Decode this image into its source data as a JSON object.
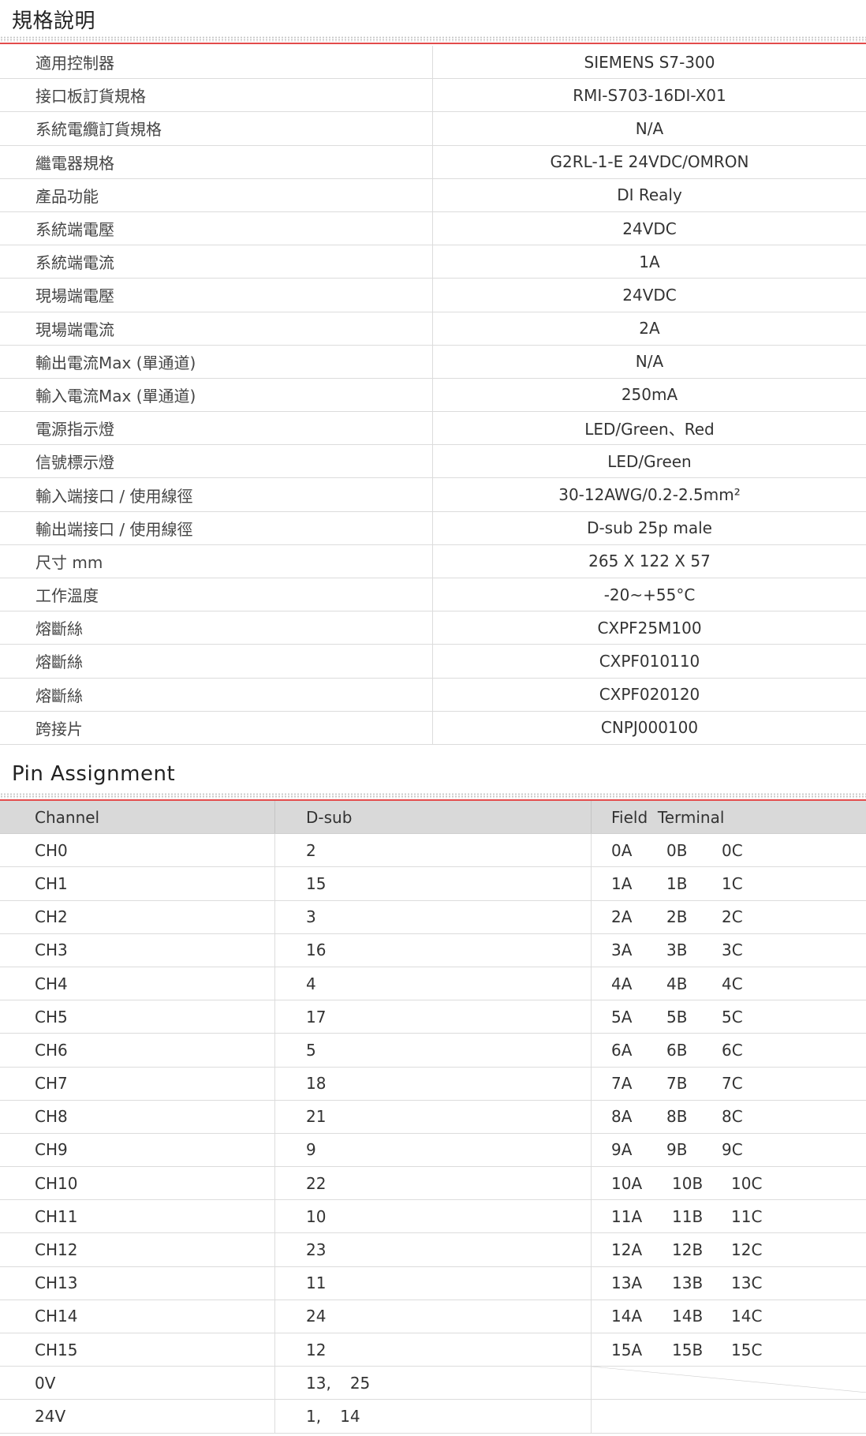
{
  "spec_section": {
    "title": "規格說明",
    "rows": [
      {
        "label": "適用控制器",
        "value": "SIEMENS S7-300"
      },
      {
        "label": "接口板訂貨規格",
        "value": "RMI-S703-16DI-X01"
      },
      {
        "label": "系統電纜訂貨規格",
        "value": "N/A"
      },
      {
        "label": "繼電器規格",
        "value": "G2RL-1-E 24VDC/OMRON"
      },
      {
        "label": "產品功能",
        "value": "DI Realy"
      },
      {
        "label": "系統端電壓",
        "value": "24VDC"
      },
      {
        "label": "系統端電流",
        "value": "1A"
      },
      {
        "label": "現場端電壓",
        "value": "24VDC"
      },
      {
        "label": "現場端電流",
        "value": "2A"
      },
      {
        "label": "輸出電流Max (單通道)",
        "value": "N/A"
      },
      {
        "label": "輸入電流Max (單通道)",
        "value": "250mA"
      },
      {
        "label": "電源指示燈",
        "value": "LED/Green、Red"
      },
      {
        "label": "信號標示燈",
        "value": "LED/Green"
      },
      {
        "label": "輸入端接口 / 使用線徑",
        "value": "30-12AWG/0.2-2.5mm²"
      },
      {
        "label": "輸出端接口 / 使用線徑",
        "value": "D-sub 25p male"
      },
      {
        "label": "尺寸 mm",
        "value": "265 X 122 X 57"
      },
      {
        "label": "工作溫度",
        "value": "-20~+55°C"
      },
      {
        "label": "熔斷絲",
        "value": "CXPF25M100"
      },
      {
        "label": "熔斷絲",
        "value": "CXPF010110"
      },
      {
        "label": "熔斷絲",
        "value": "CXPF020120"
      },
      {
        "label": "跨接片",
        "value": "CNPJ000100"
      }
    ]
  },
  "pin_section": {
    "title": "Pin Assignment",
    "headers": {
      "channel": "Channel",
      "dsub": "D-sub",
      "field": "Field  Terminal"
    },
    "rows": [
      {
        "channel": "CH0",
        "dsub": [
          "2"
        ],
        "terminals": [
          "0A",
          "0B",
          "0C"
        ]
      },
      {
        "channel": "CH1",
        "dsub": [
          "15"
        ],
        "terminals": [
          "1A",
          "1B",
          "1C"
        ]
      },
      {
        "channel": "CH2",
        "dsub": [
          "3"
        ],
        "terminals": [
          "2A",
          "2B",
          "2C"
        ]
      },
      {
        "channel": "CH3",
        "dsub": [
          "16"
        ],
        "terminals": [
          "3A",
          "3B",
          "3C"
        ]
      },
      {
        "channel": "CH4",
        "dsub": [
          "4"
        ],
        "terminals": [
          "4A",
          "4B",
          "4C"
        ]
      },
      {
        "channel": "CH5",
        "dsub": [
          "17"
        ],
        "terminals": [
          "5A",
          "5B",
          "5C"
        ]
      },
      {
        "channel": "CH6",
        "dsub": [
          "5"
        ],
        "terminals": [
          "6A",
          "6B",
          "6C"
        ]
      },
      {
        "channel": "CH7",
        "dsub": [
          "18"
        ],
        "terminals": [
          "7A",
          "7B",
          "7C"
        ]
      },
      {
        "channel": "CH8",
        "dsub": [
          "21"
        ],
        "terminals": [
          "8A",
          "8B",
          "8C"
        ]
      },
      {
        "channel": "CH9",
        "dsub": [
          "9"
        ],
        "terminals": [
          "9A",
          "9B",
          "9C"
        ]
      },
      {
        "channel": "CH10",
        "dsub": [
          "22"
        ],
        "terminals": [
          "10A",
          "10B",
          "10C"
        ]
      },
      {
        "channel": "CH11",
        "dsub": [
          "10"
        ],
        "terminals": [
          "11A",
          "11B",
          "11C"
        ]
      },
      {
        "channel": "CH12",
        "dsub": [
          "23"
        ],
        "terminals": [
          "12A",
          "12B",
          "12C"
        ]
      },
      {
        "channel": "CH13",
        "dsub": [
          "11"
        ],
        "terminals": [
          "13A",
          "13B",
          "13C"
        ]
      },
      {
        "channel": "CH14",
        "dsub": [
          "24"
        ],
        "terminals": [
          "14A",
          "14B",
          "14C"
        ]
      },
      {
        "channel": "CH15",
        "dsub": [
          "12"
        ],
        "terminals": [
          "15A",
          "15B",
          "15C"
        ]
      },
      {
        "channel": "0V",
        "dsub": [
          "13,",
          "25"
        ],
        "terminals": []
      },
      {
        "channel": "24V",
        "dsub": [
          "1,",
          "14"
        ],
        "terminals": []
      }
    ]
  },
  "colors": {
    "accent_line": "#e34b4b",
    "header_bg": "#d9d9d9",
    "row_border": "#dcdcdc"
  }
}
